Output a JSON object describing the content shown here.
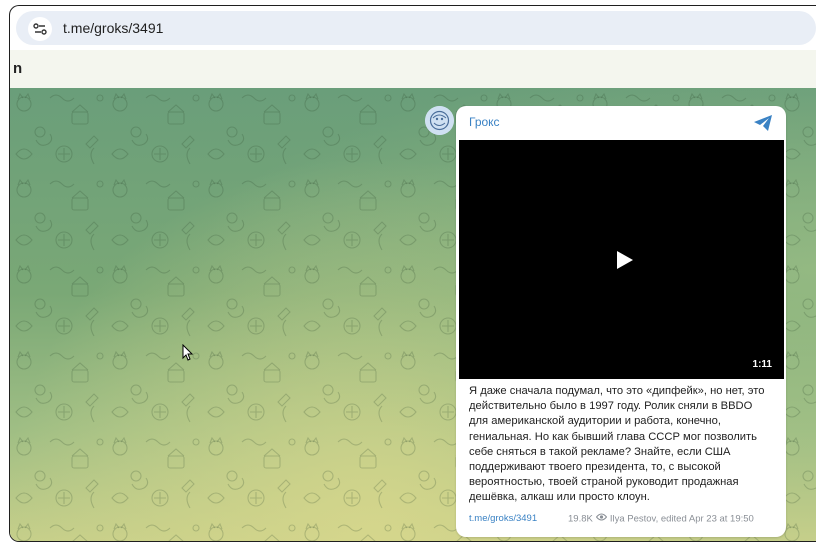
{
  "browser": {
    "url": "t.me/groks/3491"
  },
  "banner": {
    "text": "n"
  },
  "post": {
    "channel_name": "Грокс",
    "video": {
      "duration": "1:11"
    },
    "text_lines": [
      "Я даже сначала подумал, что это «дипфейк», но нет, это",
      "действительно было в 1997 году. Ролик сняли в BBDO",
      "для американской аудитории и работа, конечно,",
      "гениальная. Но как бывший глава СССР мог позволить",
      "себе сняться в такой рекламе? Знайте, если США",
      "поддерживают твоего президента, то, с высокой",
      "вероятностью, твоей страной руководит продажная",
      "дешёвка, алкаш или просто клоун."
    ],
    "link": "t.me/groks/3491",
    "views": "19.8K",
    "author_edit": "Ilya Pestov, edited Apr 23 at 19:50"
  },
  "colors": {
    "accent": "#3a82c4",
    "video_bg": "#000000",
    "chat_bg_top": "#6a9e7a",
    "chat_bg_bottom": "#c6cf8a"
  },
  "icons": {
    "site_info": "site-settings-icon",
    "channel": "telegram-plane-icon",
    "play": "play-icon",
    "views": "eye-icon"
  }
}
